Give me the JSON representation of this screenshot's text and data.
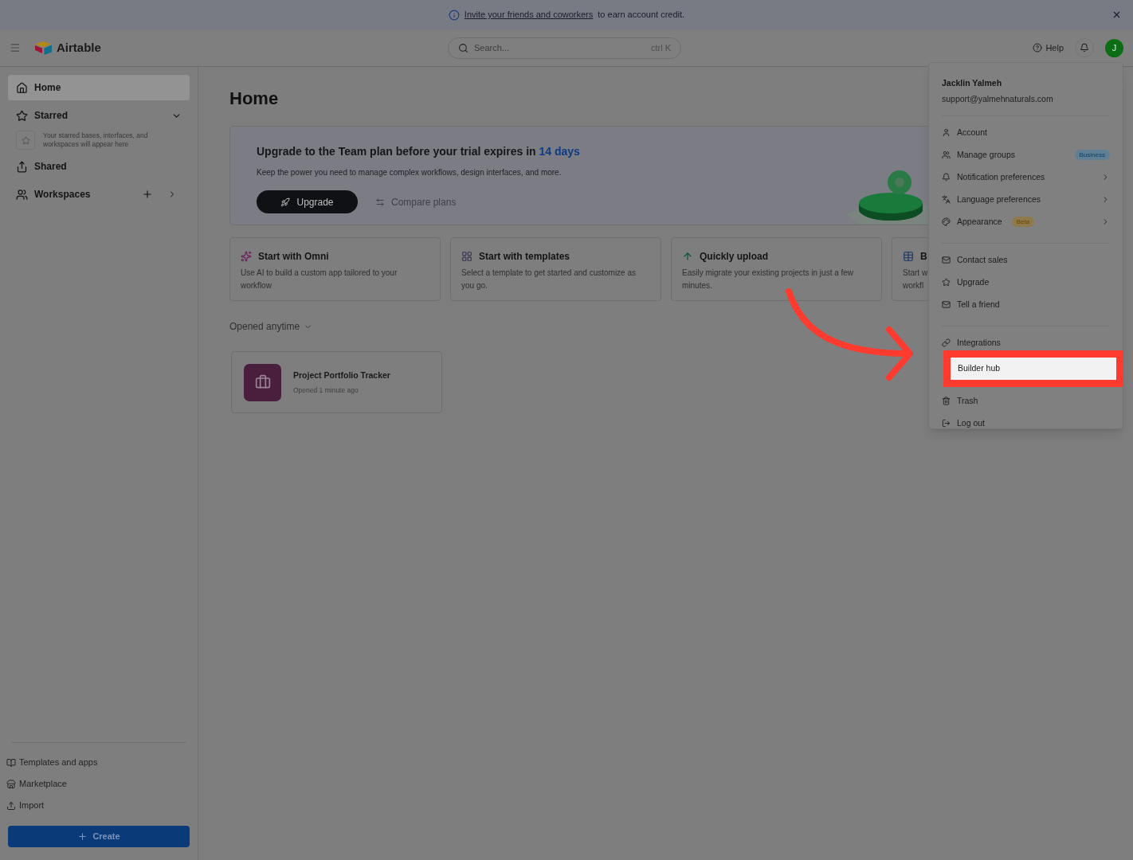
{
  "notice": {
    "link": "Invite your friends and coworkers",
    "text": "to earn account credit."
  },
  "header": {
    "logo": "Airtable",
    "search": {
      "placeholder": "Search...",
      "shortcut": "ctrl K"
    },
    "help": "Help",
    "avatar": "J"
  },
  "sidebar": {
    "items": [
      {
        "label": "Home",
        "selected": true
      },
      {
        "label": "Starred",
        "selected": false,
        "expanded": true,
        "hint": "Your starred bases, interfaces, and workspaces will appear here"
      },
      {
        "label": "Shared",
        "selected": false
      },
      {
        "label": "Workspaces",
        "selected": false
      }
    ],
    "footer": [
      {
        "label": "Templates and apps"
      },
      {
        "label": "Marketplace"
      },
      {
        "label": "Import"
      }
    ],
    "create": "Create"
  },
  "page": {
    "title": "Home",
    "banner": {
      "title": "Upgrade to the Team plan before your trial expires in ",
      "days": "14 days",
      "text": "Keep the power you need to manage complex workflows, design interfaces, and more.",
      "primary": "Upgrade",
      "secondary": "Compare plans"
    },
    "cards": [
      {
        "title": "Start with Omni",
        "text": "Use AI to build a custom app tailored to your workflow"
      },
      {
        "title": "Start with templates",
        "text": "Select a template to get started and customize as you go."
      },
      {
        "title": "Quickly upload",
        "text": "Easily migrate your existing projects in just a few minutes."
      },
      {
        "title": "B",
        "text": "Start w\nworkfl"
      }
    ],
    "filter": "Opened anytime",
    "bases": [
      {
        "name": "Project Portfolio Tracker",
        "opened": "Opened 1 minute ago",
        "color": "#4a1f3d"
      }
    ]
  },
  "menu": {
    "name": "Jacklin Yalmeh",
    "email": "support@yalmehnaturals.com",
    "groups": [
      [
        {
          "label": "Account",
          "submenu": false,
          "highlighted": false
        },
        {
          "label": "Manage groups",
          "submenu": false,
          "highlighted": false,
          "badge": {
            "text": "Business",
            "kind": "business"
          }
        },
        {
          "label": "Notification preferences",
          "submenu": true,
          "highlighted": false
        },
        {
          "label": "Language preferences",
          "submenu": true,
          "highlighted": false
        },
        {
          "label": "Appearance",
          "submenu": true,
          "highlighted": false,
          "badge": {
            "text": "Beta",
            "kind": "beta"
          }
        }
      ],
      [
        {
          "label": "Contact sales",
          "submenu": false,
          "highlighted": false
        },
        {
          "label": "Upgrade",
          "submenu": false,
          "highlighted": false
        },
        {
          "label": "Tell a friend",
          "submenu": false,
          "highlighted": false
        }
      ],
      [
        {
          "label": "Integrations",
          "submenu": false,
          "highlighted": false
        },
        {
          "label": "Builder hub",
          "submenu": false,
          "highlighted": true
        },
        {
          "label": "Trash",
          "submenu": false,
          "highlighted": false
        },
        {
          "label": "Log out",
          "submenu": false,
          "highlighted": false
        }
      ]
    ]
  }
}
